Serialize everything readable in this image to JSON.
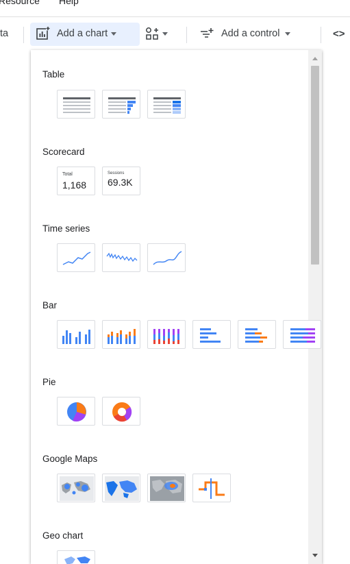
{
  "menubar": {
    "items": [
      "Resource",
      "Help"
    ]
  },
  "toolbar": {
    "data_label": "ta",
    "add_chart_label": "Add a chart",
    "add_control_label": "Add a control",
    "code_label": "<>"
  },
  "sections": {
    "table": "Table",
    "scorecard": "Scorecard",
    "time_series": "Time series",
    "bar": "Bar",
    "pie": "Pie",
    "google_maps": "Google Maps",
    "geo_chart": "Geo chart"
  },
  "scorecards": [
    {
      "label": "Total",
      "value": "1,168"
    },
    {
      "label": "Sessions",
      "value": "69.3K"
    }
  ],
  "colors": {
    "accent": "#4285f4",
    "accent_dark": "#1a73e8",
    "purple": "#a142f4",
    "orange": "#fa7b17",
    "active_bg": "#e8f0fe"
  }
}
